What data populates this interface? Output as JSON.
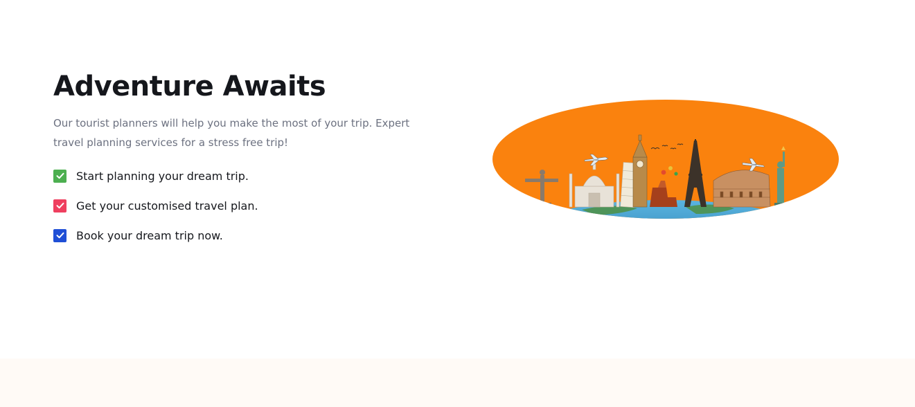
{
  "hero": {
    "title": "Adventure Awaits",
    "description": "Our tourist planners will help you make the most of your trip. Expert travel planning services for a stress free trip!",
    "features": [
      {
        "label": "Start planning your dream trip.",
        "icon": "check-icon",
        "color": "#4caf50"
      },
      {
        "label": "Get your customised travel plan.",
        "icon": "check-icon",
        "color": "#ef3f5f"
      },
      {
        "label": "Book your dream trip now.",
        "icon": "check-icon",
        "color": "#1f4fd6"
      }
    ]
  },
  "colors": {
    "heading": "#15171c",
    "body_text": "#6c7180",
    "oval_background": "#fa820e",
    "bottom_band": "#fffaf6"
  }
}
